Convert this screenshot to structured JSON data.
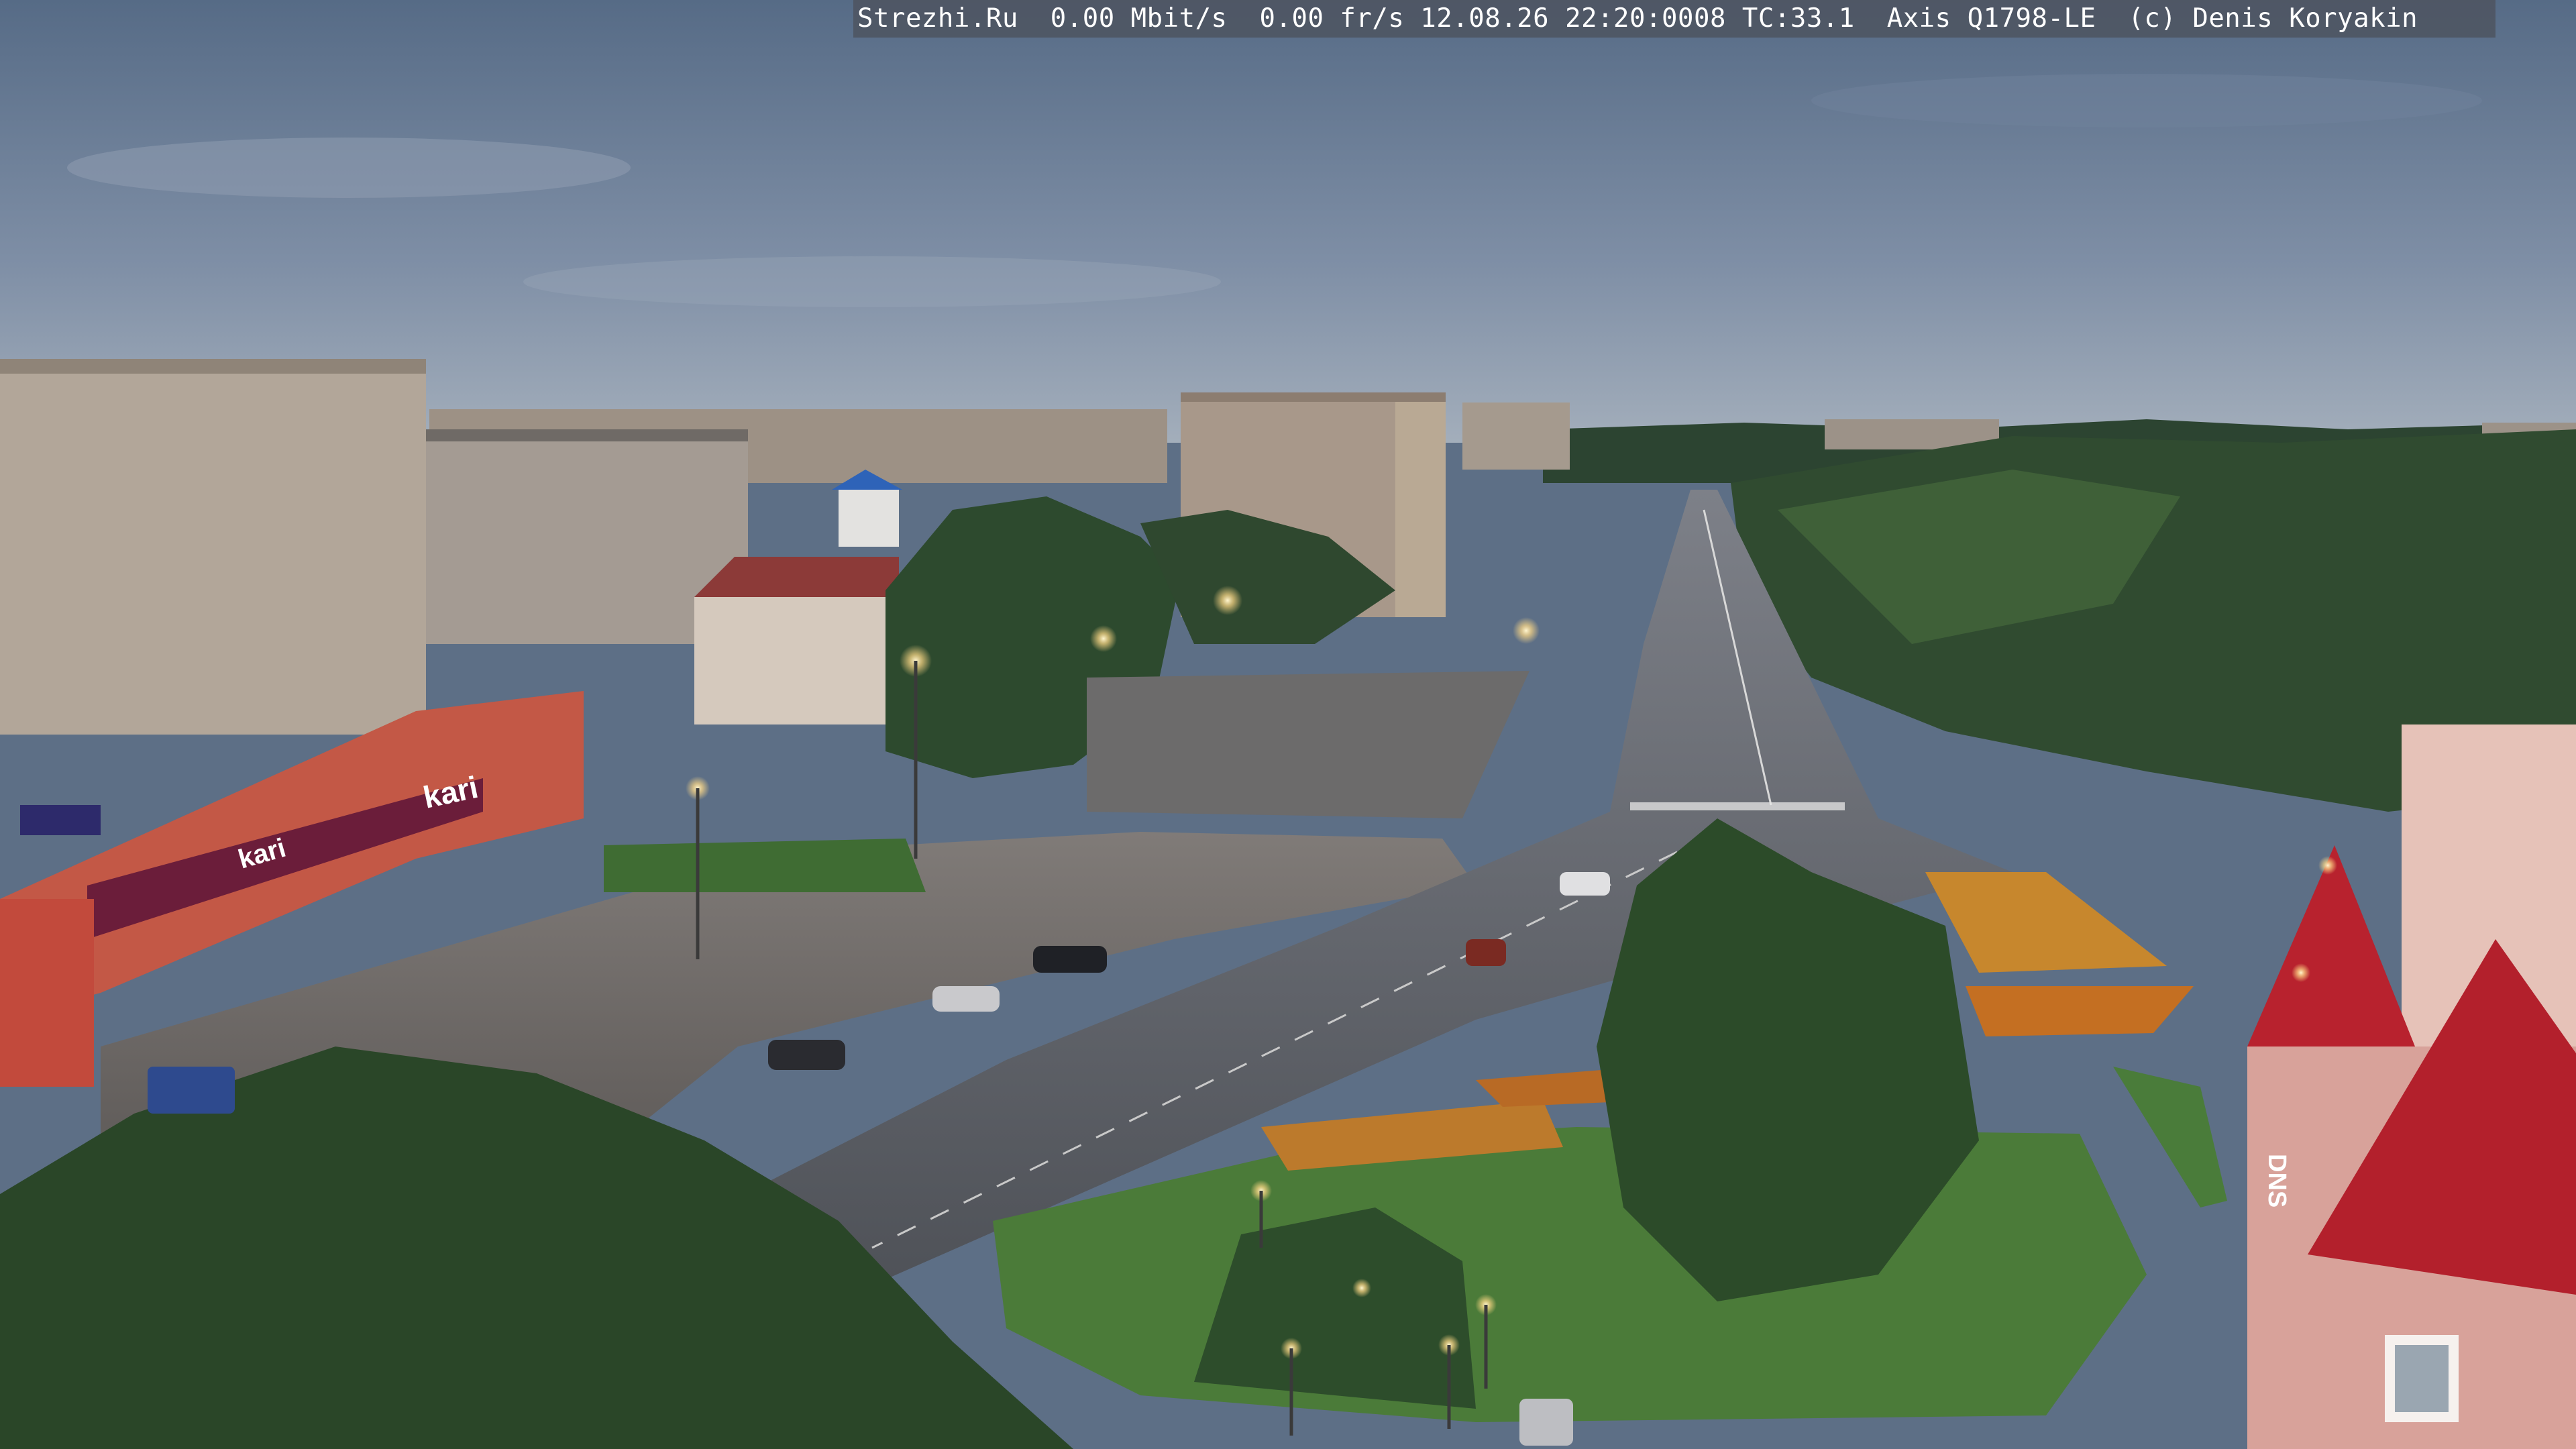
{
  "overlay": {
    "text": "Strezhi.Ru  0.00 Mbit/s  0.00 fr/s 12.08.26 22:20:0008 TC:33.1  Axis Q1798-LE  (c) Denis Koryakin"
  },
  "signs": {
    "store_main": "kari",
    "store_small": "kari",
    "dns": "DNS"
  },
  "colors": {
    "sky_top": "#5b6f88",
    "sky_bottom": "#9aa7b5",
    "forest": "#2f4a33",
    "road": "#5c5f63",
    "square": "#6e6b68",
    "lawn": "#4c7a3a",
    "store_facade": "#c0584a",
    "kari_banner": "#6b1d3a",
    "roof_red": "#b8222e",
    "pink_building": "#d9a29a",
    "panel_building": "#a99b8e",
    "lamp_glow": "#ffdf8f",
    "overlay_bg": "#4e5663"
  }
}
